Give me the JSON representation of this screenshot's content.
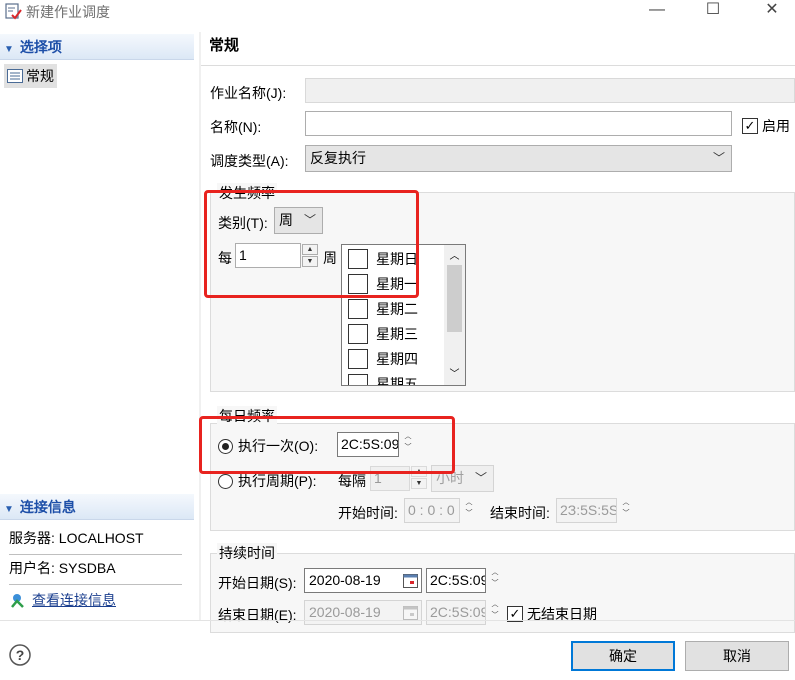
{
  "window": {
    "title": "新建作业调度",
    "minimize": "—",
    "maximize": "☐",
    "close": "✕"
  },
  "sidebar": {
    "options_header": "选择项",
    "items": [
      {
        "label": "常规",
        "icon": "form-list-icon"
      }
    ],
    "conn_header": "连接信息",
    "server": "服务器: LOCALHOST",
    "user": "用户名: SYSDBA",
    "view_conn": "查看连接信息"
  },
  "form": {
    "section_title": "常规",
    "job_name_label": "作业名称(J):",
    "job_name_value": "",
    "name_label": "名称(N):",
    "name_value": "",
    "enabled_label": "启用",
    "enabled": true,
    "schedule_type_label": "调度类型(A):",
    "schedule_type_value": "反复执行",
    "frequency": {
      "title": "发生频率",
      "type_label": "类别(T):",
      "type_value": "周",
      "every_label": "每",
      "every_value": "1",
      "every_unit": "周",
      "days": [
        {
          "label": "星期日",
          "checked": false
        },
        {
          "label": "星期一",
          "checked": false
        },
        {
          "label": "星期二",
          "checked": false
        },
        {
          "label": "星期三",
          "checked": false
        },
        {
          "label": "星期四",
          "checked": false
        },
        {
          "label": "星期五",
          "checked": false
        }
      ]
    },
    "daily": {
      "title": "每日频率",
      "once_label": "执行一次(O):",
      "once_time": "20:59:09",
      "once_time_shown": "2C:5S:09",
      "period_label": "执行周期(P):",
      "period_every_label": "每隔",
      "period_value": "1",
      "period_unit": "小时",
      "start_time_label": "开始时间:",
      "start_time": "0 : 0 : 0",
      "end_time_label": "结束时间:",
      "end_time": "23:59:59",
      "end_time_shown": "2З:5S:5S"
    },
    "duration": {
      "title": "持续时间",
      "start_date_label": "开始日期(S):",
      "start_date": "2020-08-19",
      "start_time": "20:59:09",
      "start_time_shown": "2C:5S:09",
      "end_date_label": "结束日期(E):",
      "end_date": "2020-08-19",
      "end_time_shown": "2C:5S:09",
      "no_end_label": "无结束日期",
      "no_end": true
    }
  },
  "footer": {
    "help_icon": "help-circle-icon",
    "ok": "确定",
    "cancel": "取消"
  },
  "colors": {
    "accent": "#0078d7",
    "header_text": "#1d4fa8",
    "highlight_box": "#e8231f"
  }
}
